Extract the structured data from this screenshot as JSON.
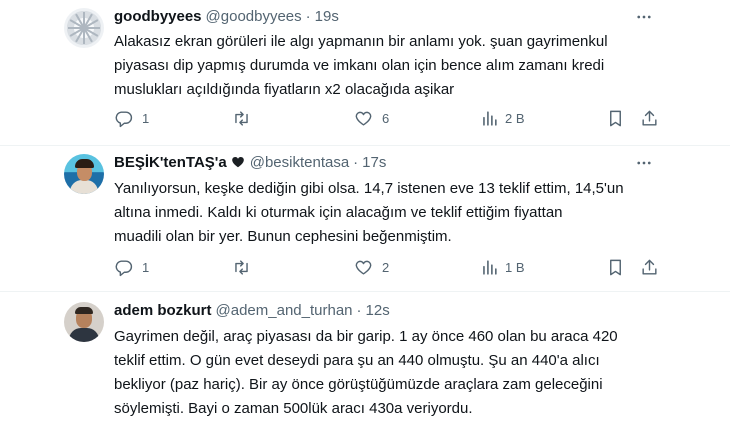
{
  "tweets": [
    {
      "name": "goodbyyees",
      "handle": "@goodbyyees",
      "separator": "·",
      "time": "19s",
      "lines": [
        "Alakasız ekran görüleri ile algı yapmanın bir anlamı yok. şuan gayrimenkul",
        "piyasası dip yapmış durumda ve imkanı olan için bence alım zamanı kredi",
        "muslukları açıldığında fiyatların x2 olacağıda aşikar"
      ],
      "replies": "1",
      "retweets": "",
      "likes": "6",
      "views": "2 B"
    },
    {
      "name": "BEŞİK'tenTAŞ'a",
      "handle": "@besiktentasa",
      "separator": "·",
      "time": "17s",
      "lines": [
        "Yanılıyorsun, keşke dediğin gibi olsa. 14,7 istenen eve 13 teklif ettim, 14,5'un",
        "altına inmedi. Kaldı ki oturmak için alacağım ve teklif ettiğim fiyattan",
        "muadili olan bir yer. Bunun cephesini beğenmiştim."
      ],
      "replies": "1",
      "retweets": "",
      "likes": "2",
      "views": "1 B"
    },
    {
      "name": "adem bozkurt",
      "handle": "@adem_and_turhan",
      "separator": "·",
      "time": "12s",
      "lines": [
        "Gayrimen değil, araç piyasası da bir garip. 1 ay önce 460 olan bu araca 420",
        "teklif ettim. O gün evet deseydi para şu an 440 olmuştu. Şu an 440'a alıcı",
        "bekliyor (paz hariç). Bir ay önce görüştüğümüzde araçlara zam geleceğini",
        "söylemişti. Bayi o zaman 500lük aracı 430a veriyordu."
      ]
    }
  ],
  "icons": {
    "reply": "reply-icon",
    "retweet": "retweet-icon",
    "like": "heart-icon",
    "views": "views-icon",
    "bookmark": "bookmark-icon",
    "share": "share-icon",
    "more": "more-icon"
  },
  "colors": {
    "text": "#0f1419",
    "secondary": "#536471",
    "divider": "#eff3f4"
  }
}
